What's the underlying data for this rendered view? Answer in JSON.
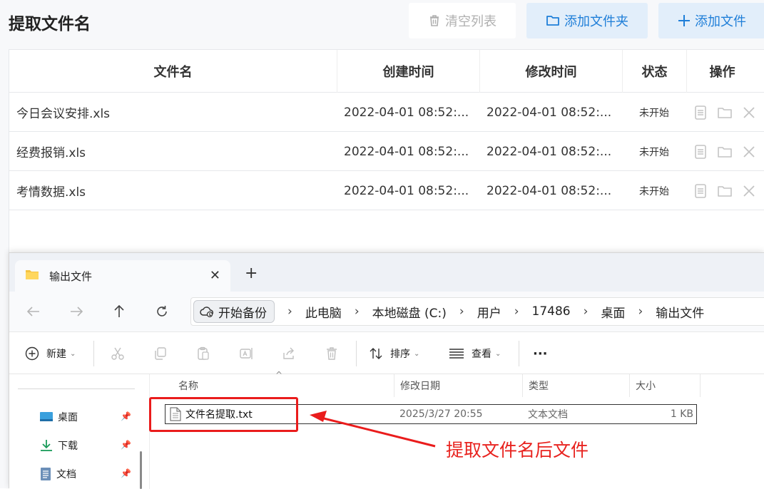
{
  "app": {
    "title": "提取文件名",
    "buttons": {
      "clear": "清空列表",
      "add_folder": "添加文件夹",
      "add_file": "添加文件"
    }
  },
  "table": {
    "headers": [
      "文件名",
      "创建时间",
      "修改时间",
      "状态",
      "操作"
    ],
    "rows": [
      {
        "name": "今日会议安排.xls",
        "created": "2022-04-01 08:52:...",
        "modified": "2022-04-01 08:52:...",
        "status": "未开始"
      },
      {
        "name": "经费报销.xls",
        "created": "2022-04-01 08:52:...",
        "modified": "2022-04-01 08:52:...",
        "status": "未开始"
      },
      {
        "name": "考情数据.xls",
        "created": "2022-04-01 08:52:...",
        "modified": "2022-04-01 08:52:...",
        "status": "未开始"
      }
    ]
  },
  "explorer": {
    "tab_title": "输出文件",
    "address": {
      "backup": "开始备份",
      "crumbs": [
        "此电脑",
        "本地磁盘 (C:)",
        "用户",
        "17486",
        "桌面",
        "输出文件"
      ]
    },
    "commands": {
      "new": "新建",
      "sort": "排序",
      "view": "查看",
      "more": "···"
    },
    "sidebar": [
      {
        "label": "桌面",
        "icon": "desktop-icon"
      },
      {
        "label": "下载",
        "icon": "download-icon"
      },
      {
        "label": "文档",
        "icon": "document-icon"
      }
    ],
    "columns": [
      "名称",
      "修改日期",
      "类型",
      "大小"
    ],
    "file": {
      "name": "文件名提取.txt",
      "modified": "2025/3/27 20:55",
      "type": "文本文档",
      "size": "1 KB"
    }
  },
  "annotation": {
    "label": "提取文件名后文件",
    "color": "#e8231f"
  },
  "colors": {
    "accent": "#1e7ed8",
    "accent_bg": "#e2eefa",
    "annotation_red": "#ea1c1c"
  }
}
